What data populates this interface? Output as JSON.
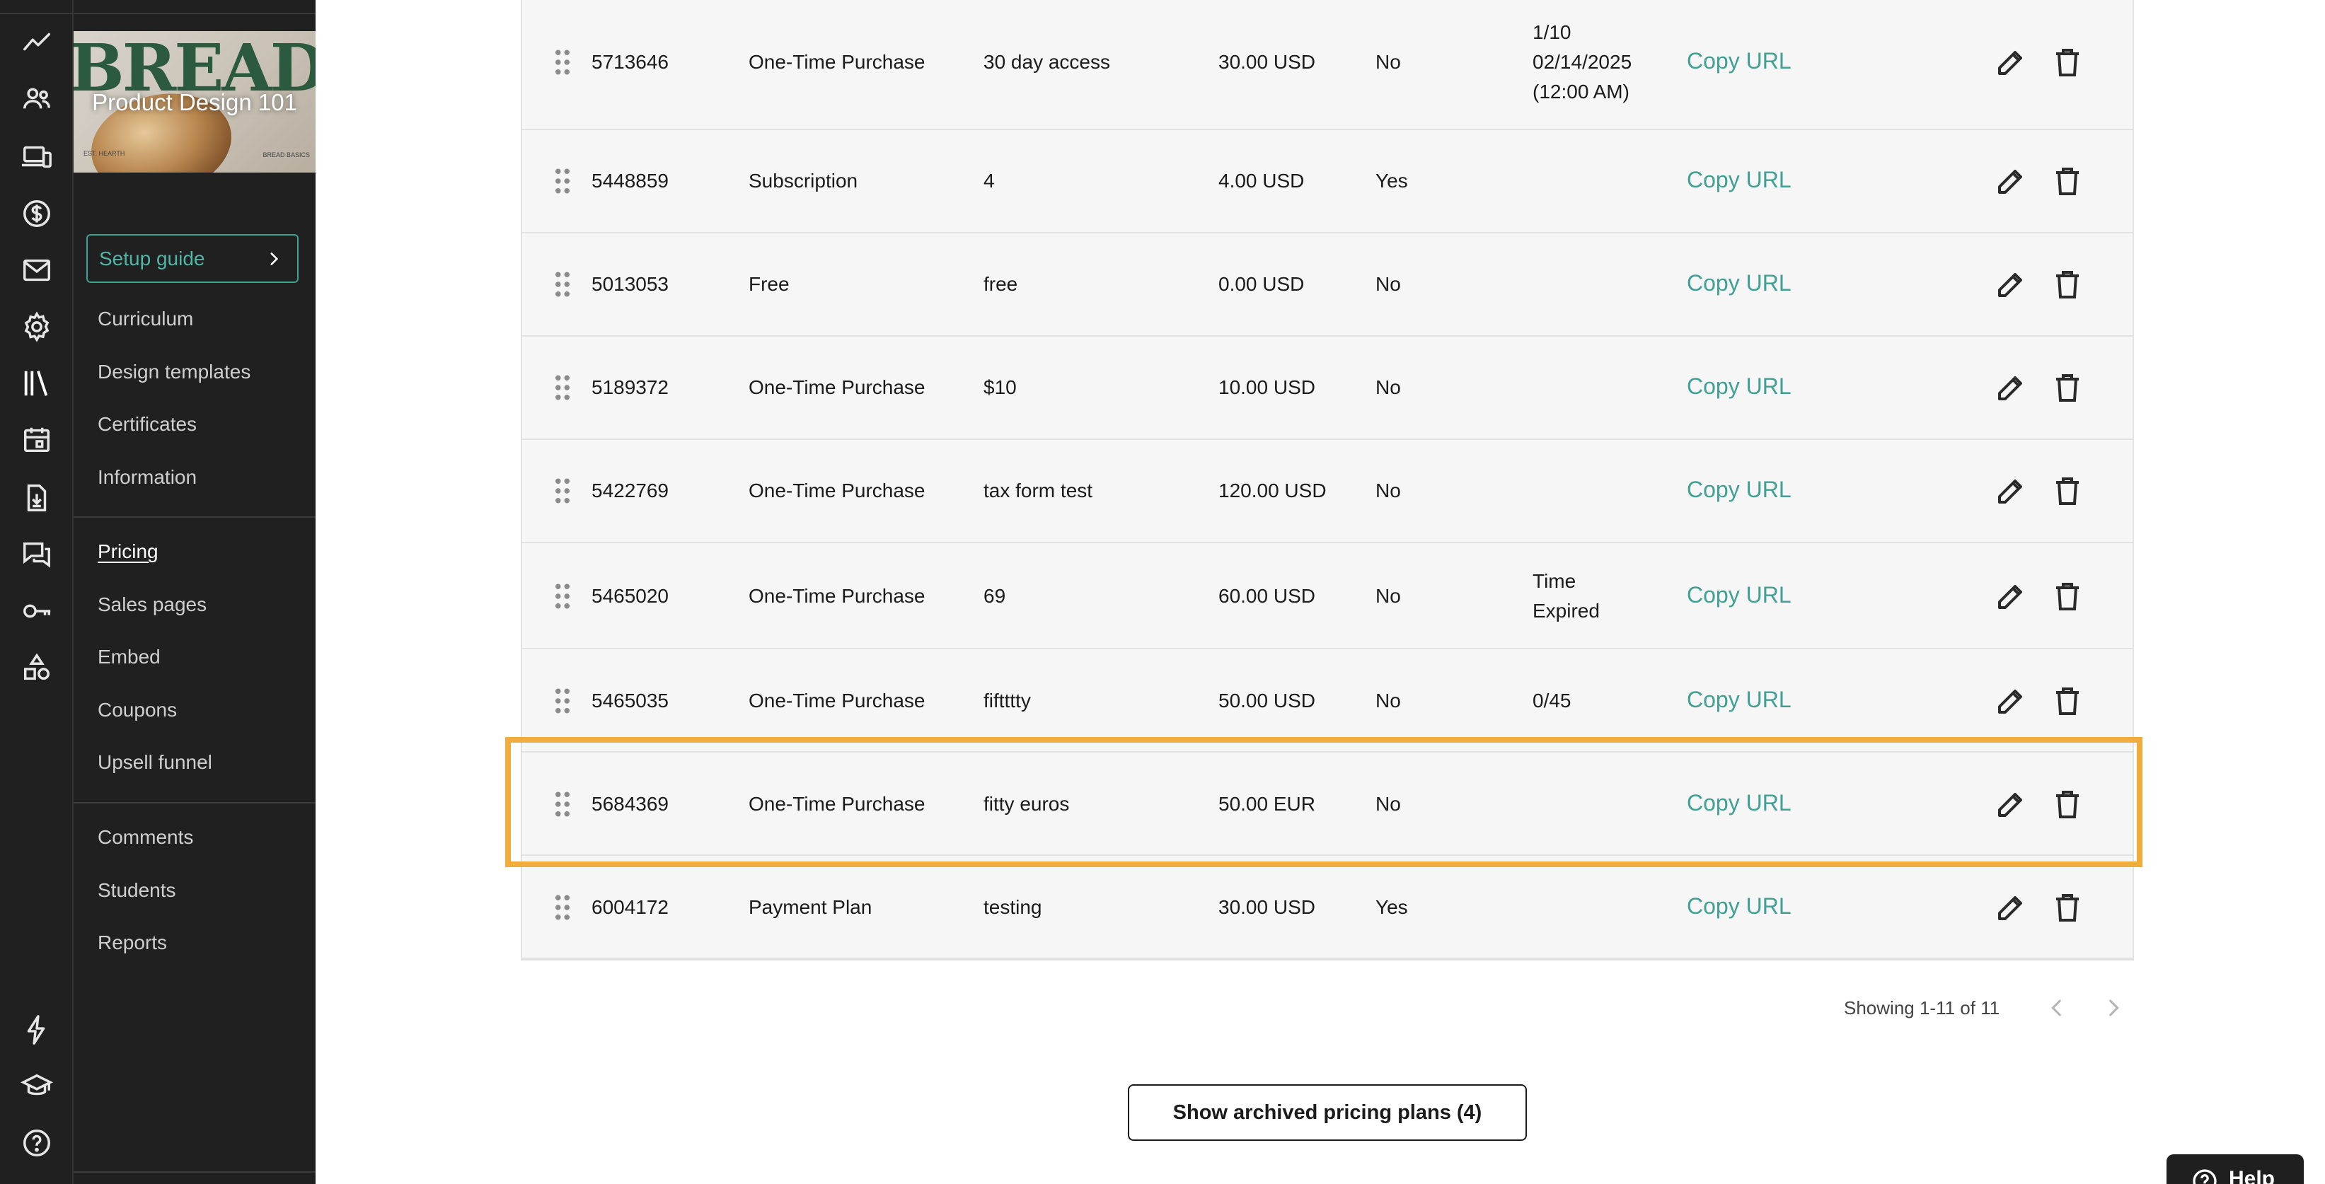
{
  "course": {
    "title": "Product Design 101",
    "cover_text": "BREADCIPES",
    "cover_small_left": "EST. HEARTH",
    "cover_small_right": "BREAD BASICS"
  },
  "rail_icons": [
    "analytics-icon",
    "users-icon",
    "devices-icon",
    "dollar-icon",
    "mail-icon",
    "settings-icon",
    "library-icon",
    "calendar-icon",
    "download-icon",
    "chat-icon",
    "key-icon",
    "shapes-icon",
    "bolt-icon",
    "graduation-cap-icon",
    "help-circle-icon"
  ],
  "sidebar": {
    "setup_guide": "Setup guide",
    "group1": [
      "Curriculum",
      "Design templates",
      "Certificates",
      "Information"
    ],
    "group2": [
      "Pricing",
      "Sales pages",
      "Embed",
      "Coupons",
      "Upsell funnel"
    ],
    "group3": [
      "Comments",
      "Students",
      "Reports"
    ],
    "active": "Pricing"
  },
  "table": {
    "copy_label": "Copy URL",
    "rows": [
      {
        "id": "5713646",
        "type": "One-Time Purchase",
        "name": "30 day access",
        "price": "30.00 USD",
        "default": "No",
        "limit": [
          "1/10",
          "02/14/2025",
          "(12:00 AM)"
        ]
      },
      {
        "id": "5448859",
        "type": "Subscription",
        "name": "4",
        "price": "4.00 USD",
        "default": "Yes",
        "limit": []
      },
      {
        "id": "5013053",
        "type": "Free",
        "name": "free",
        "price": "0.00 USD",
        "default": "No",
        "limit": []
      },
      {
        "id": "5189372",
        "type": "One-Time Purchase",
        "name": "$10",
        "price": "10.00 USD",
        "default": "No",
        "limit": []
      },
      {
        "id": "5422769",
        "type": "One-Time Purchase",
        "name": "tax form test",
        "price": "120.00 USD",
        "default": "No",
        "limit": []
      },
      {
        "id": "5465020",
        "type": "One-Time Purchase",
        "name": "69",
        "price": "60.00 USD",
        "default": "No",
        "limit": [
          "Time",
          "Expired"
        ]
      },
      {
        "id": "5465035",
        "type": "One-Time Purchase",
        "name": "fiftttty",
        "price": "50.00 USD",
        "default": "No",
        "limit": [
          "0/45"
        ]
      },
      {
        "id": "5684369",
        "type": "One-Time Purchase",
        "name": "fitty euros",
        "price": "50.00 EUR",
        "default": "No",
        "limit": []
      },
      {
        "id": "6004172",
        "type": "Payment Plan",
        "name": "testing",
        "price": "30.00 USD",
        "default": "Yes",
        "limit": []
      }
    ],
    "highlighted_id": "5684369"
  },
  "pagination": {
    "showing": "Showing 1-11 of 11"
  },
  "archived_button": "Show archived pricing plans (4)",
  "help_label": "Help",
  "colors": {
    "accent": "#3fa093",
    "highlight": "#f0ad3c",
    "sidebar_bg": "#202020"
  }
}
